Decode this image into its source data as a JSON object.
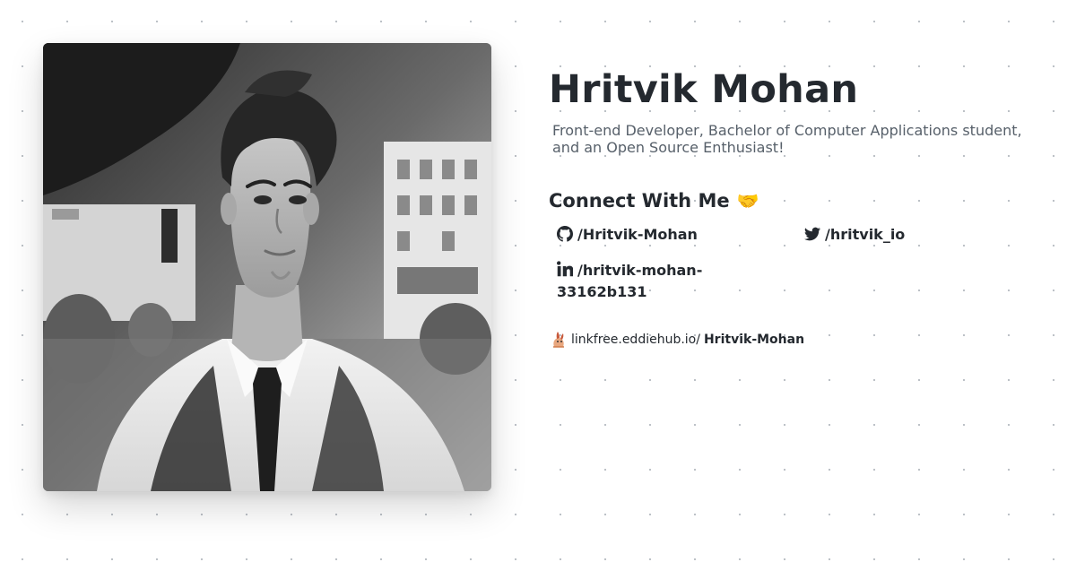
{
  "profile": {
    "name": "Hritvik Mohan",
    "bio": "Front-end Developer, Bachelor of Computer Applications student, and an Open Source Enthusiast!",
    "photo_icon": "avatar-portrait"
  },
  "connect": {
    "heading": "Connect With Me",
    "heading_emoji": "🤝",
    "links": [
      {
        "platform": "GitHub",
        "icon": "github-icon",
        "label": "/Hritvik-Mohan"
      },
      {
        "platform": "Twitter",
        "icon": "twitter-icon",
        "label": "/hritvik_io"
      },
      {
        "platform": "LinkedIn",
        "icon": "linkedin-icon",
        "label": "/hritvik-mohan-33162b131"
      }
    ]
  },
  "linkfree": {
    "icon": "linkfree-logo-icon",
    "prefix": "linkfree.eddiehub.io/",
    "username": "Hritvik-Mohan"
  },
  "colors": {
    "text": "#24292f",
    "muted": "#57606a",
    "dot_grid": "#b9bec4",
    "background": "#ffffff"
  }
}
